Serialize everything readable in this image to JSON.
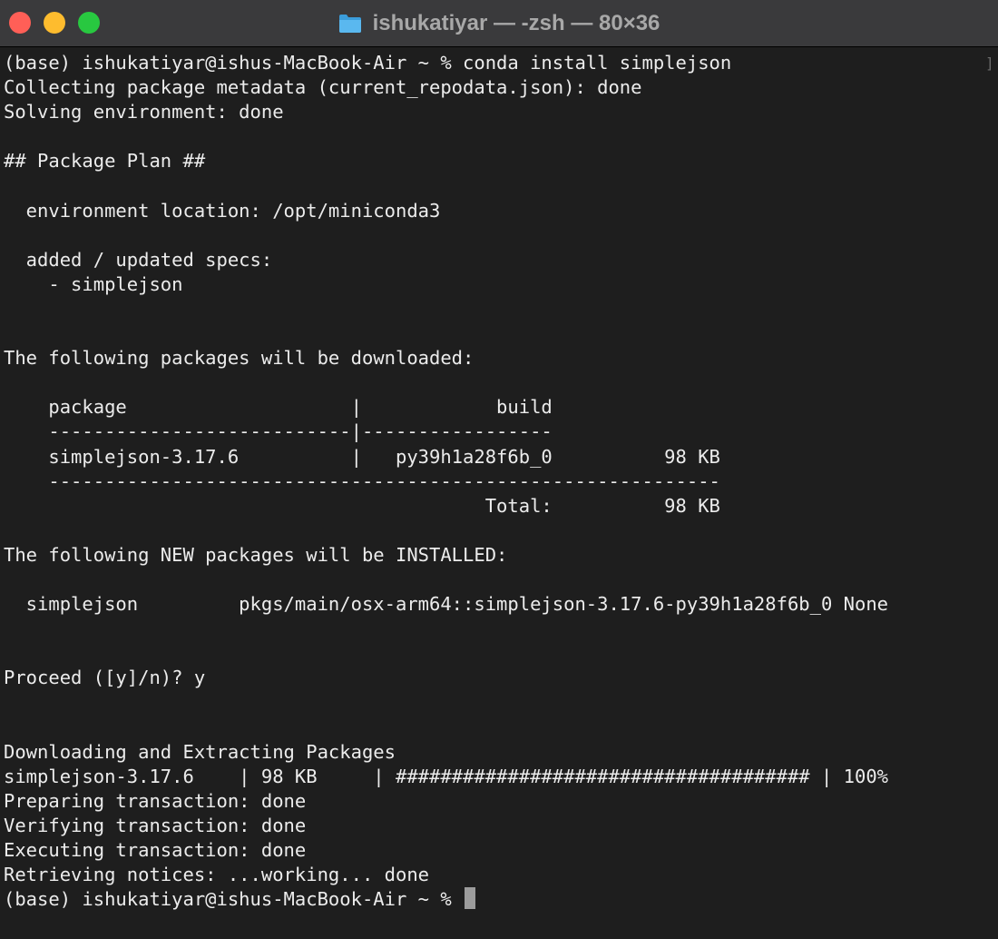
{
  "window": {
    "title": "ishukatiyar — -zsh — 80×36"
  },
  "terminal": {
    "lines": [
      "(base) ishukatiyar@ishus-MacBook-Air ~ % conda install simplejson",
      "Collecting package metadata (current_repodata.json): done",
      "Solving environment: done",
      "",
      "## Package Plan ##",
      "",
      "  environment location: /opt/miniconda3",
      "",
      "  added / updated specs:",
      "    - simplejson",
      "",
      "",
      "The following packages will be downloaded:",
      "",
      "    package                    |            build",
      "    ---------------------------|-----------------",
      "    simplejson-3.17.6          |   py39h1a28f6b_0          98 KB",
      "    ------------------------------------------------------------",
      "                                           Total:          98 KB",
      "",
      "The following NEW packages will be INSTALLED:",
      "",
      "  simplejson         pkgs/main/osx-arm64::simplejson-3.17.6-py39h1a28f6b_0 None",
      "",
      "",
      "Proceed ([y]/n)? y",
      "",
      "",
      "Downloading and Extracting Packages",
      "simplejson-3.17.6    | 98 KB     | ##################################### | 100%",
      "Preparing transaction: done",
      "Verifying transaction: done",
      "Executing transaction: done",
      "Retrieving notices: ...working... done"
    ],
    "prompt": "(base) ishukatiyar@ishus-MacBook-Air ~ % ",
    "scroll_indicator": "]"
  }
}
